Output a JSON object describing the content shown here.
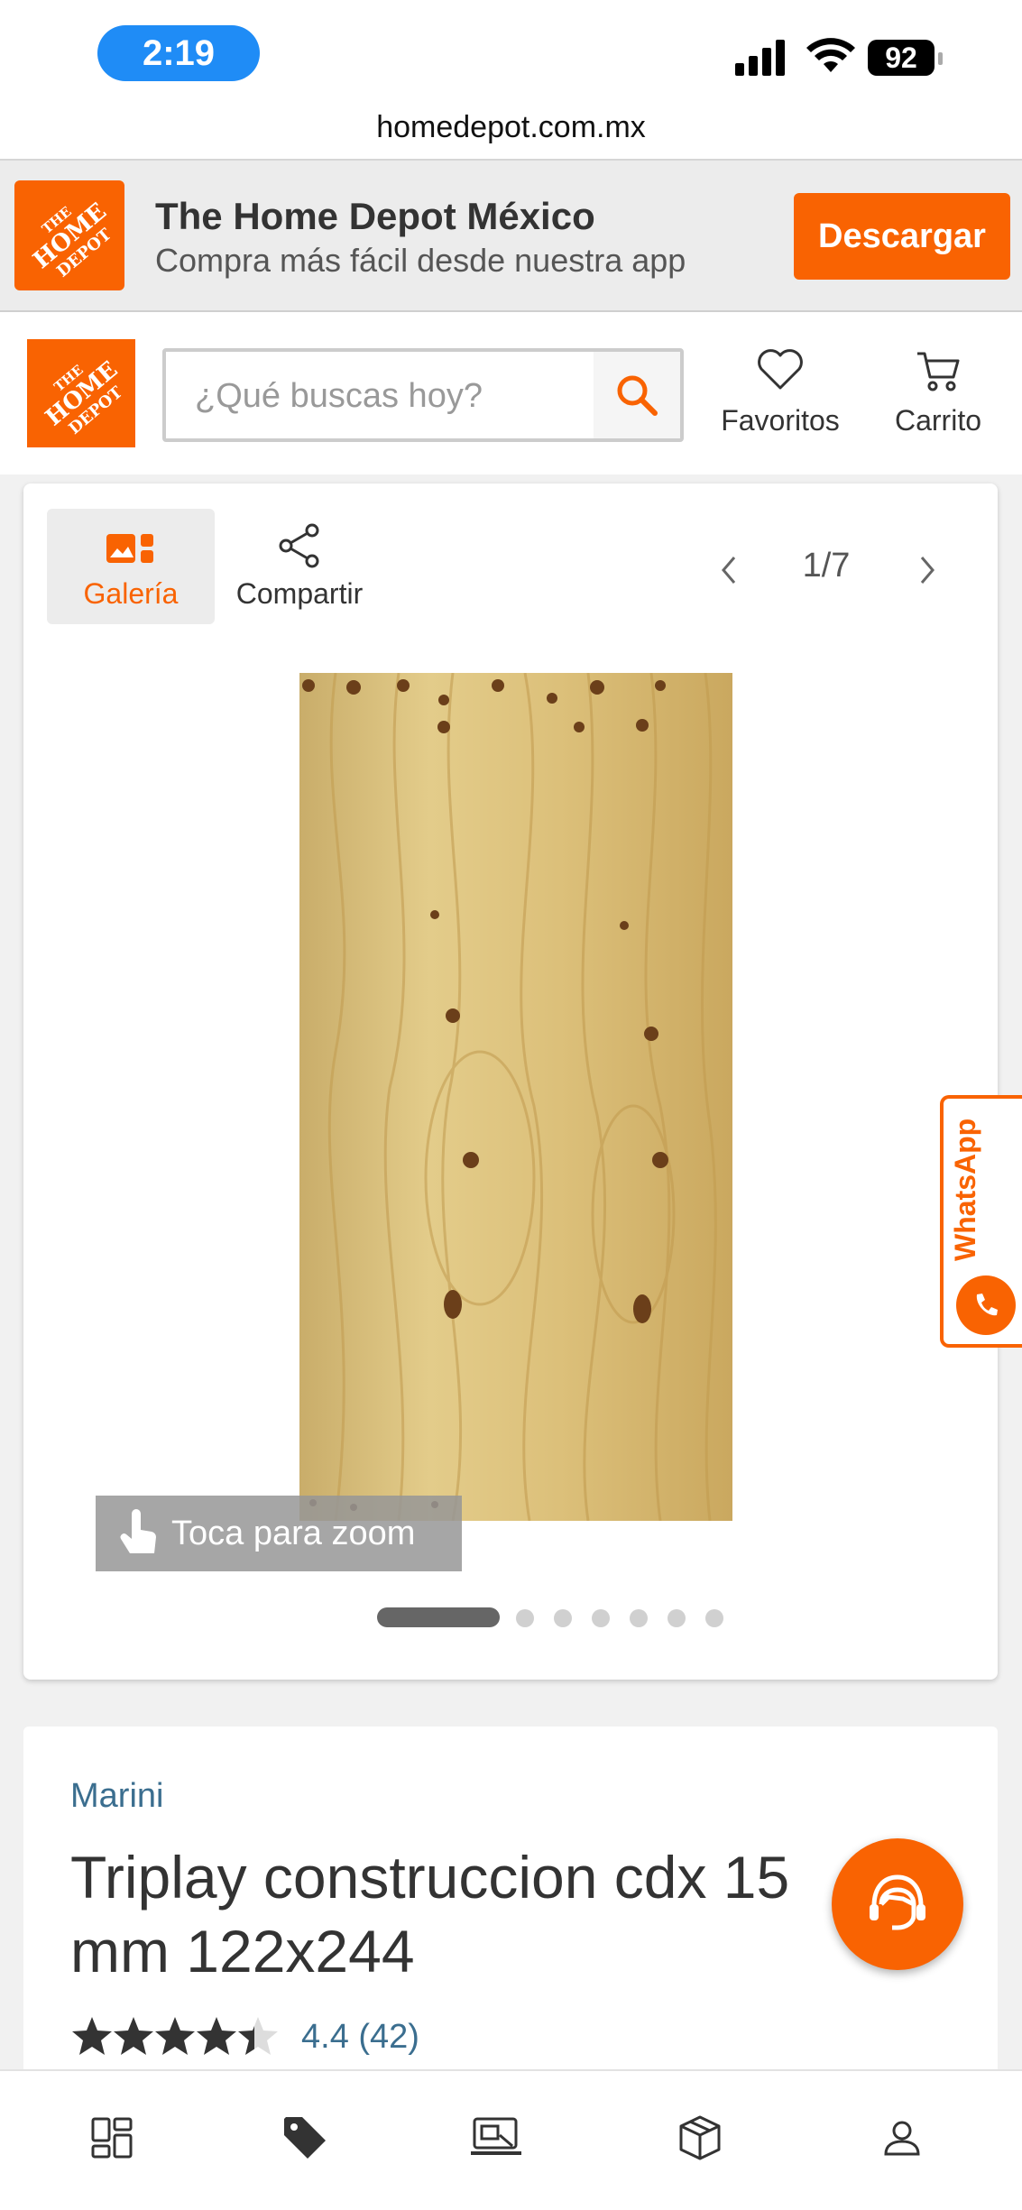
{
  "status_bar": {
    "time": "2:19",
    "battery": "92"
  },
  "browser": {
    "url": "homedepot.com.mx"
  },
  "app_banner": {
    "logo_text": "THE HOME DEPOT",
    "title": "The Home Depot México",
    "subtitle": "Compra más fácil desde nuestra app",
    "download_label": "Descargar"
  },
  "header": {
    "logo_text": "THE HOME DEPOT",
    "search_placeholder": "¿Qué buscas hoy?",
    "favorites_label": "Favoritos",
    "cart_label": "Carrito"
  },
  "gallery": {
    "tab_gallery": "Galería",
    "tab_share": "Compartir",
    "counter": "1/7",
    "zoom_hint": "Toca para zoom",
    "image_count": 7,
    "active_index": 0
  },
  "whatsapp": {
    "label": "WhatsApp"
  },
  "product": {
    "brand": "Marini",
    "title": "Triplay construccion cdx 15 mm 122x244",
    "rating_value": 4.4,
    "rating_text": "4.4 (42)"
  },
  "bottom_nav": {
    "items": [
      "departments-icon",
      "deals-tag-icon",
      "delivery-icon",
      "package-icon",
      "account-icon"
    ]
  },
  "colors": {
    "brand_orange": "#f96302",
    "link_blue": "#3b6e8f"
  }
}
